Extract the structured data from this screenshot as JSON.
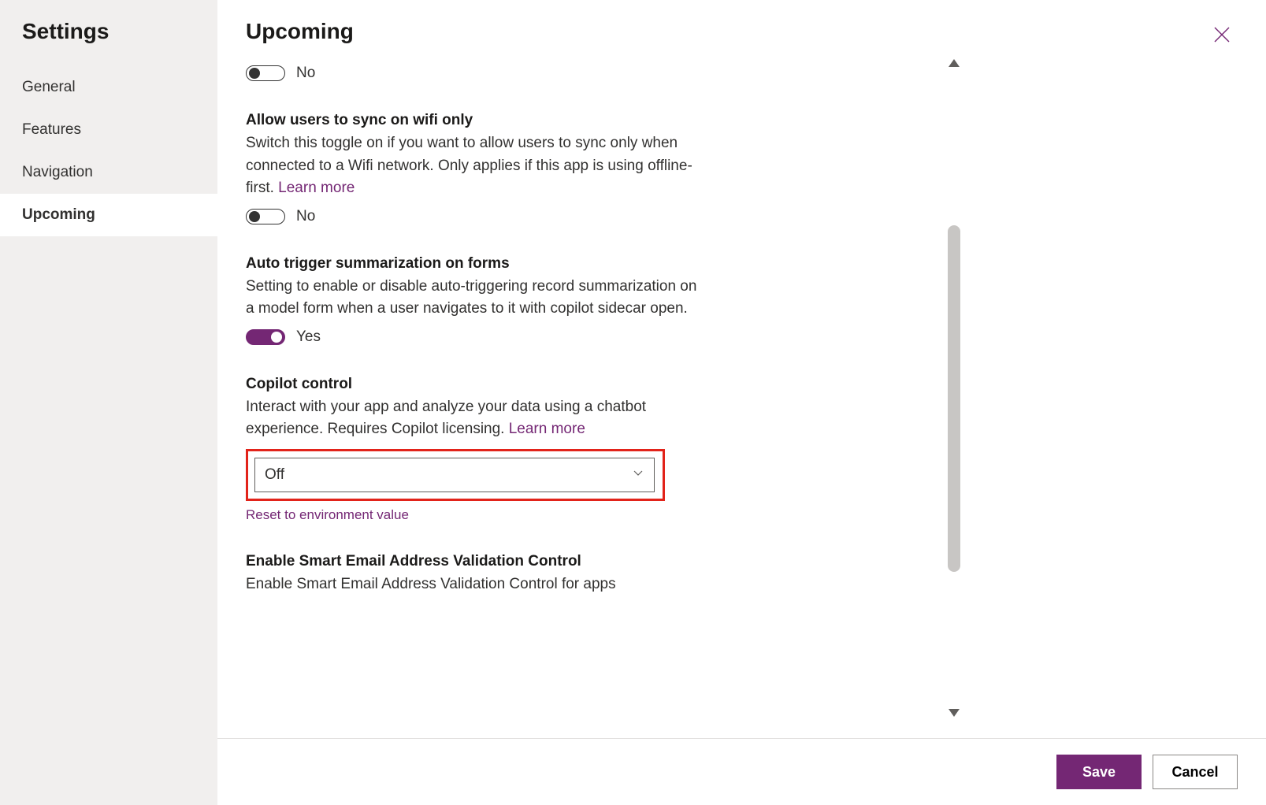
{
  "sidebar": {
    "title": "Settings",
    "items": [
      {
        "label": "General",
        "active": false
      },
      {
        "label": "Features",
        "active": false
      },
      {
        "label": "Navigation",
        "active": false
      },
      {
        "label": "Upcoming",
        "active": true
      }
    ]
  },
  "header": {
    "title": "Upcoming"
  },
  "settings": {
    "first_toggle": {
      "value_label": "No",
      "on": false
    },
    "wifi": {
      "title": "Allow users to sync on wifi only",
      "desc": "Switch this toggle on if you want to allow users to sync only when connected to a Wifi network. Only applies if this app is using offline-first. ",
      "learn_more": "Learn more",
      "value_label": "No",
      "on": false
    },
    "autotrigger": {
      "title": "Auto trigger summarization on forms",
      "desc": "Setting to enable or disable auto-triggering record summarization on a model form when a user navigates to it with copilot sidecar open.",
      "value_label": "Yes",
      "on": true
    },
    "copilot": {
      "title": "Copilot control",
      "desc": "Interact with your app and analyze your data using a chatbot experience. Requires Copilot licensing. ",
      "learn_more": "Learn more",
      "selected": "Off",
      "reset_label": "Reset to environment value"
    },
    "smartemail": {
      "title": "Enable Smart Email Address Validation Control",
      "desc": "Enable Smart Email Address Validation Control for apps"
    }
  },
  "footer": {
    "save": "Save",
    "cancel": "Cancel"
  }
}
